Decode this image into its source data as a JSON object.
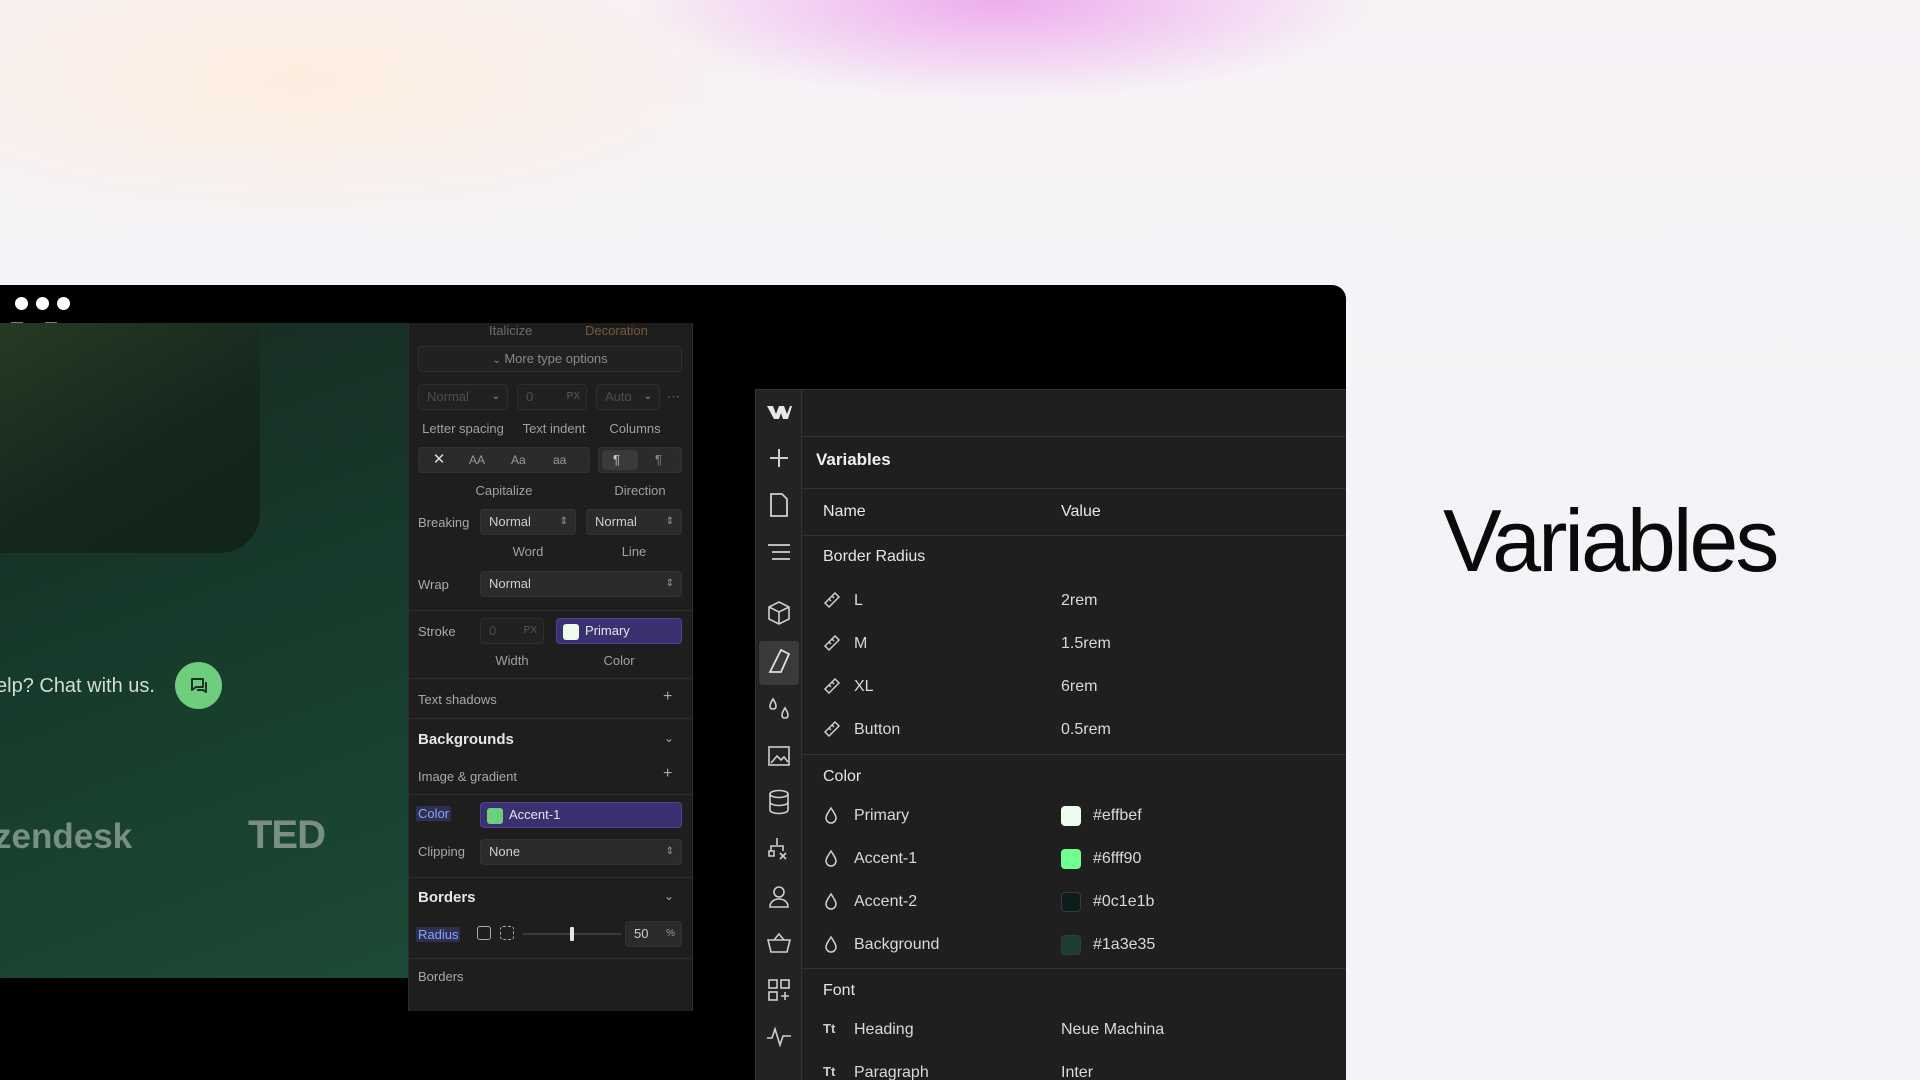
{
  "headline": "Variables",
  "colors": {
    "accent_green": "#6fce7e",
    "primary": "#effbef",
    "accent1": "#6fff90",
    "accent2": "#0c1e1b",
    "background": "#1a3e35",
    "purple_pill": "#3a3270"
  },
  "preview": {
    "chat_text": "elp? Chat with us.",
    "logo1": "zendesk",
    "logo2": "TED"
  },
  "style_panel": {
    "italicize": "Italicize",
    "decoration": "Decoration",
    "more_type_options": "More type options",
    "letter_spacing": {
      "value": "Normal",
      "label": "Letter spacing"
    },
    "text_indent": {
      "value": "0",
      "unit": "PX",
      "label": "Text indent"
    },
    "columns": {
      "value": "Auto",
      "label": "Columns"
    },
    "capitalize": {
      "options": [
        "AA",
        "Aa",
        "aa"
      ],
      "label": "Capitalize"
    },
    "direction_label": "Direction",
    "breaking": {
      "label": "Breaking",
      "word_value": "Normal",
      "word_label": "Word",
      "line_value": "Normal",
      "line_label": "Line"
    },
    "wrap": {
      "label": "Wrap",
      "value": "Normal"
    },
    "stroke": {
      "label": "Stroke",
      "width_value": "0",
      "width_unit": "PX",
      "width_label": "Width",
      "color_value": "Primary",
      "color_label": "Color"
    },
    "text_shadows": "Text shadows",
    "backgrounds": {
      "title": "Backgrounds",
      "image_gradient": "Image & gradient",
      "color_label": "Color",
      "color_value": "Accent-1",
      "clipping_label": "Clipping",
      "clipping_value": "None"
    },
    "borders": {
      "title": "Borders",
      "radius_label": "Radius",
      "radius_value": "50",
      "radius_unit": "%",
      "radius_fraction": 0.5,
      "borders_label": "Borders"
    }
  },
  "variables": {
    "title": "Variables",
    "col_name": "Name",
    "col_value": "Value",
    "groups": [
      {
        "name": "Border Radius",
        "items": [
          {
            "name": "L",
            "value": "2rem"
          },
          {
            "name": "M",
            "value": "1.5rem"
          },
          {
            "name": "XL",
            "value": "6rem"
          },
          {
            "name": "Button",
            "value": "0.5rem"
          }
        ]
      },
      {
        "name": "Color",
        "items": [
          {
            "name": "Primary",
            "value": "#effbef"
          },
          {
            "name": "Accent-1",
            "value": "#6fff90"
          },
          {
            "name": "Accent-2",
            "value": "#0c1e1b"
          },
          {
            "name": "Background",
            "value": "#1a3e35"
          }
        ]
      },
      {
        "name": "Font",
        "items": [
          {
            "name": "Heading",
            "value": "Neue Machina"
          },
          {
            "name": "Paragraph",
            "value": "Inter"
          }
        ]
      }
    ],
    "rail_icons": [
      "webflow-logo-icon",
      "add-icon",
      "page-icon",
      "navigator-icon",
      "components-icon",
      "style-icon",
      "variables-icon",
      "assets-icon",
      "cms-icon",
      "logic-icon",
      "users-icon",
      "ecommerce-icon",
      "apps-icon",
      "audit-icon"
    ]
  }
}
